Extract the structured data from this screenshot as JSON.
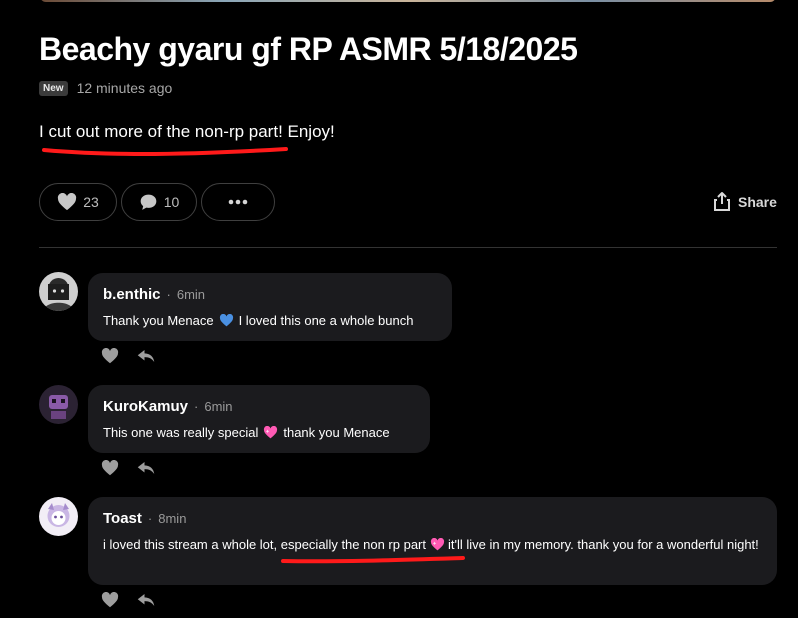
{
  "post": {
    "title": "Beachy gyaru gf RP ASMR 5/18/2025",
    "badge": "New",
    "timestamp": "12 minutes ago",
    "body": "I cut out more of the non-rp part! Enjoy!"
  },
  "actions": {
    "likes": "23",
    "comments": "10",
    "share_label": "Share"
  },
  "colors": {
    "annotation_red": "#ff1a1a",
    "heart_blue": "#4a90e2",
    "heart_pink": "#ff5ab4"
  },
  "comments": [
    {
      "username": "b.enthic",
      "time": "6min",
      "text_before": "Thank you Menace",
      "emoji": "blue-heart-icon",
      "text_after": "I loved this one a whole bunch"
    },
    {
      "username": "KuroKamuy",
      "time": "6min",
      "text_before": "This one was really special",
      "emoji": "sparkling-heart-icon",
      "text_after": "thank you Menace"
    },
    {
      "username": "Toast",
      "time": "8min",
      "text_before": "i loved this stream a whole lot, especially the non rp part",
      "emoji": "sparkling-heart-icon",
      "text_after": "it'll live in my memory. thank you for a wonderful night!"
    }
  ]
}
